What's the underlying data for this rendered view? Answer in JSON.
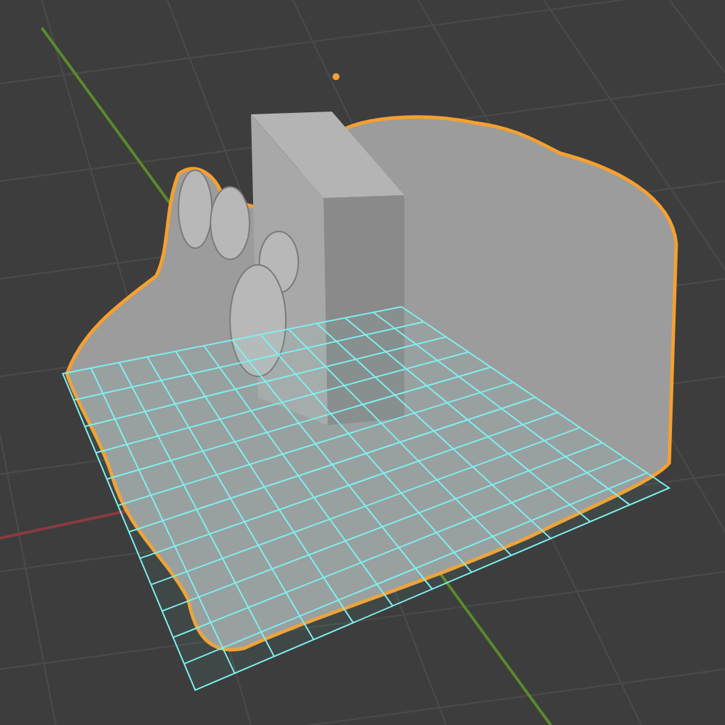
{
  "object": {
    "selected": true
  }
}
